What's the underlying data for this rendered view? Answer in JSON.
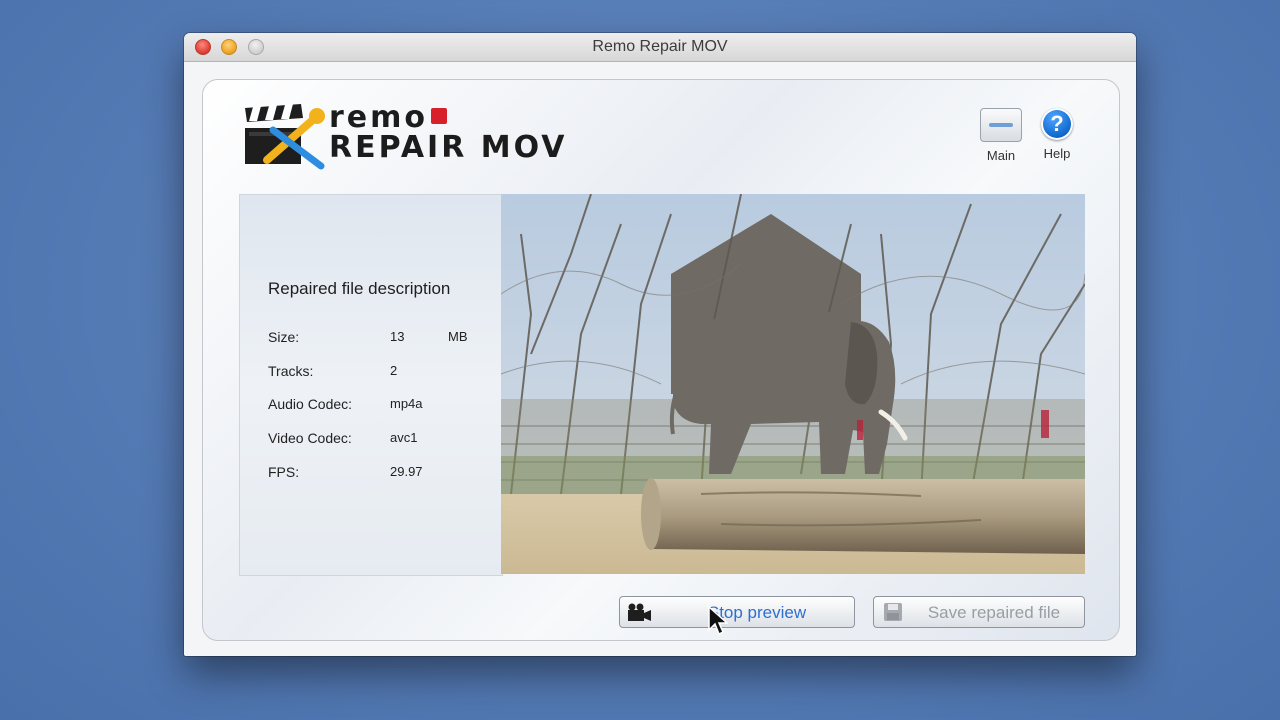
{
  "window": {
    "title": "Remo Repair MOV"
  },
  "logo": {
    "line1": "remo",
    "line2": "REPAIR MOV"
  },
  "toolbar": {
    "main_label": "Main",
    "help_label": "Help",
    "help_glyph": "?"
  },
  "description": {
    "title": "Repaired file description",
    "rows": [
      {
        "label": "Size:",
        "value": "13",
        "unit": "MB"
      },
      {
        "label": "Tracks:",
        "value": "2"
      },
      {
        "label": "Audio Codec:",
        "value": "mp4a"
      },
      {
        "label": "Video Codec:",
        "value": "avc1"
      },
      {
        "label": "FPS:",
        "value": "29.97"
      }
    ]
  },
  "buttons": {
    "stop_preview": "Stop preview",
    "save_repaired": "Save repaired file"
  },
  "colors": {
    "accent": "#2e6fd0",
    "background": "#557bb5"
  },
  "icons": {
    "camera": "video-camera-icon",
    "save": "floppy-disk-icon",
    "main": "window-icon",
    "help": "question-mark-icon"
  }
}
